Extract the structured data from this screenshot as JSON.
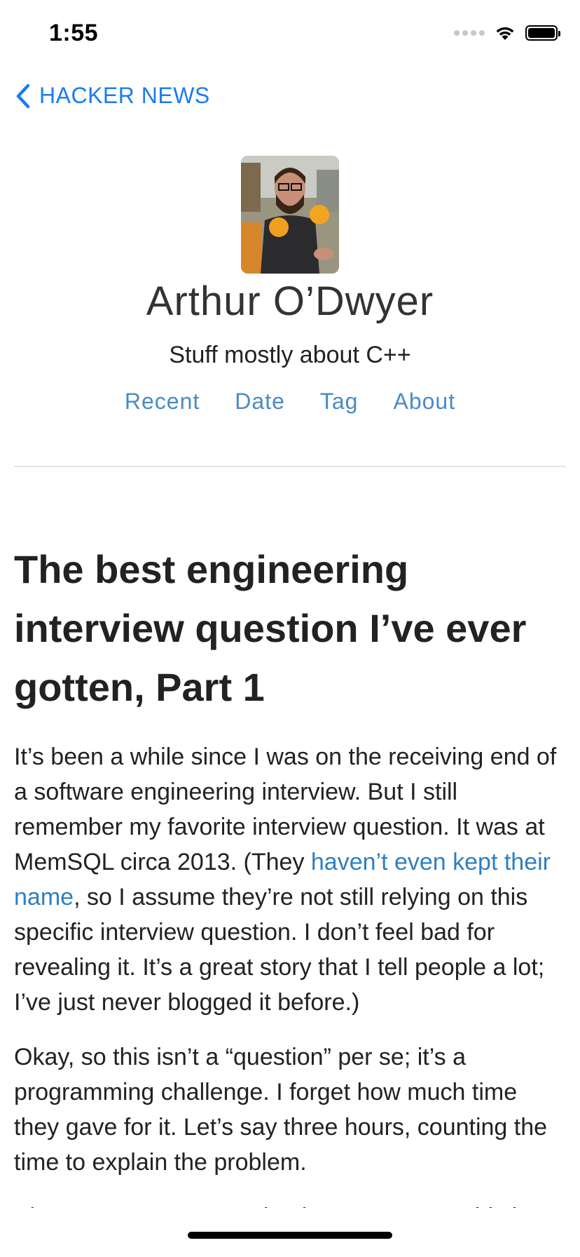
{
  "status_bar": {
    "time": "1:55"
  },
  "nav": {
    "back_label": "HACKER NEWS"
  },
  "blog": {
    "title": "Arthur O’Dwyer",
    "tagline": "Stuff mostly about C++",
    "nav_links": [
      "Recent",
      "Date",
      "Tag",
      "About"
    ]
  },
  "article": {
    "title": "The best engineering interview question I’ve ever gotten, Part 1",
    "paragraph1": {
      "before_link": "It’s been a while since I was on the receiving end of a software engineering interview. But I still remember my favorite interview question. It was at MemSQL circa 2013. (They ",
      "link_text": "haven’t even kept their name",
      "after_link": ", so I assume they’re not still relying on this specific interview question. I don’t feel bad for revealing it. It’s a great story that I tell people a lot; I’ve just never blogged it before.)"
    },
    "paragraph2": "Okay, so this isn’t a “question” per se; it’s a programming challenge. I forget how much time they gave for it. Let’s say three hours, counting the time to explain the problem.",
    "paragraph3_partial": "Since MemSQL was a database company, this is"
  },
  "colors": {
    "ios_blue": "#1a7cf0",
    "link_blue": "#4a8ac6",
    "text": "#222222"
  }
}
